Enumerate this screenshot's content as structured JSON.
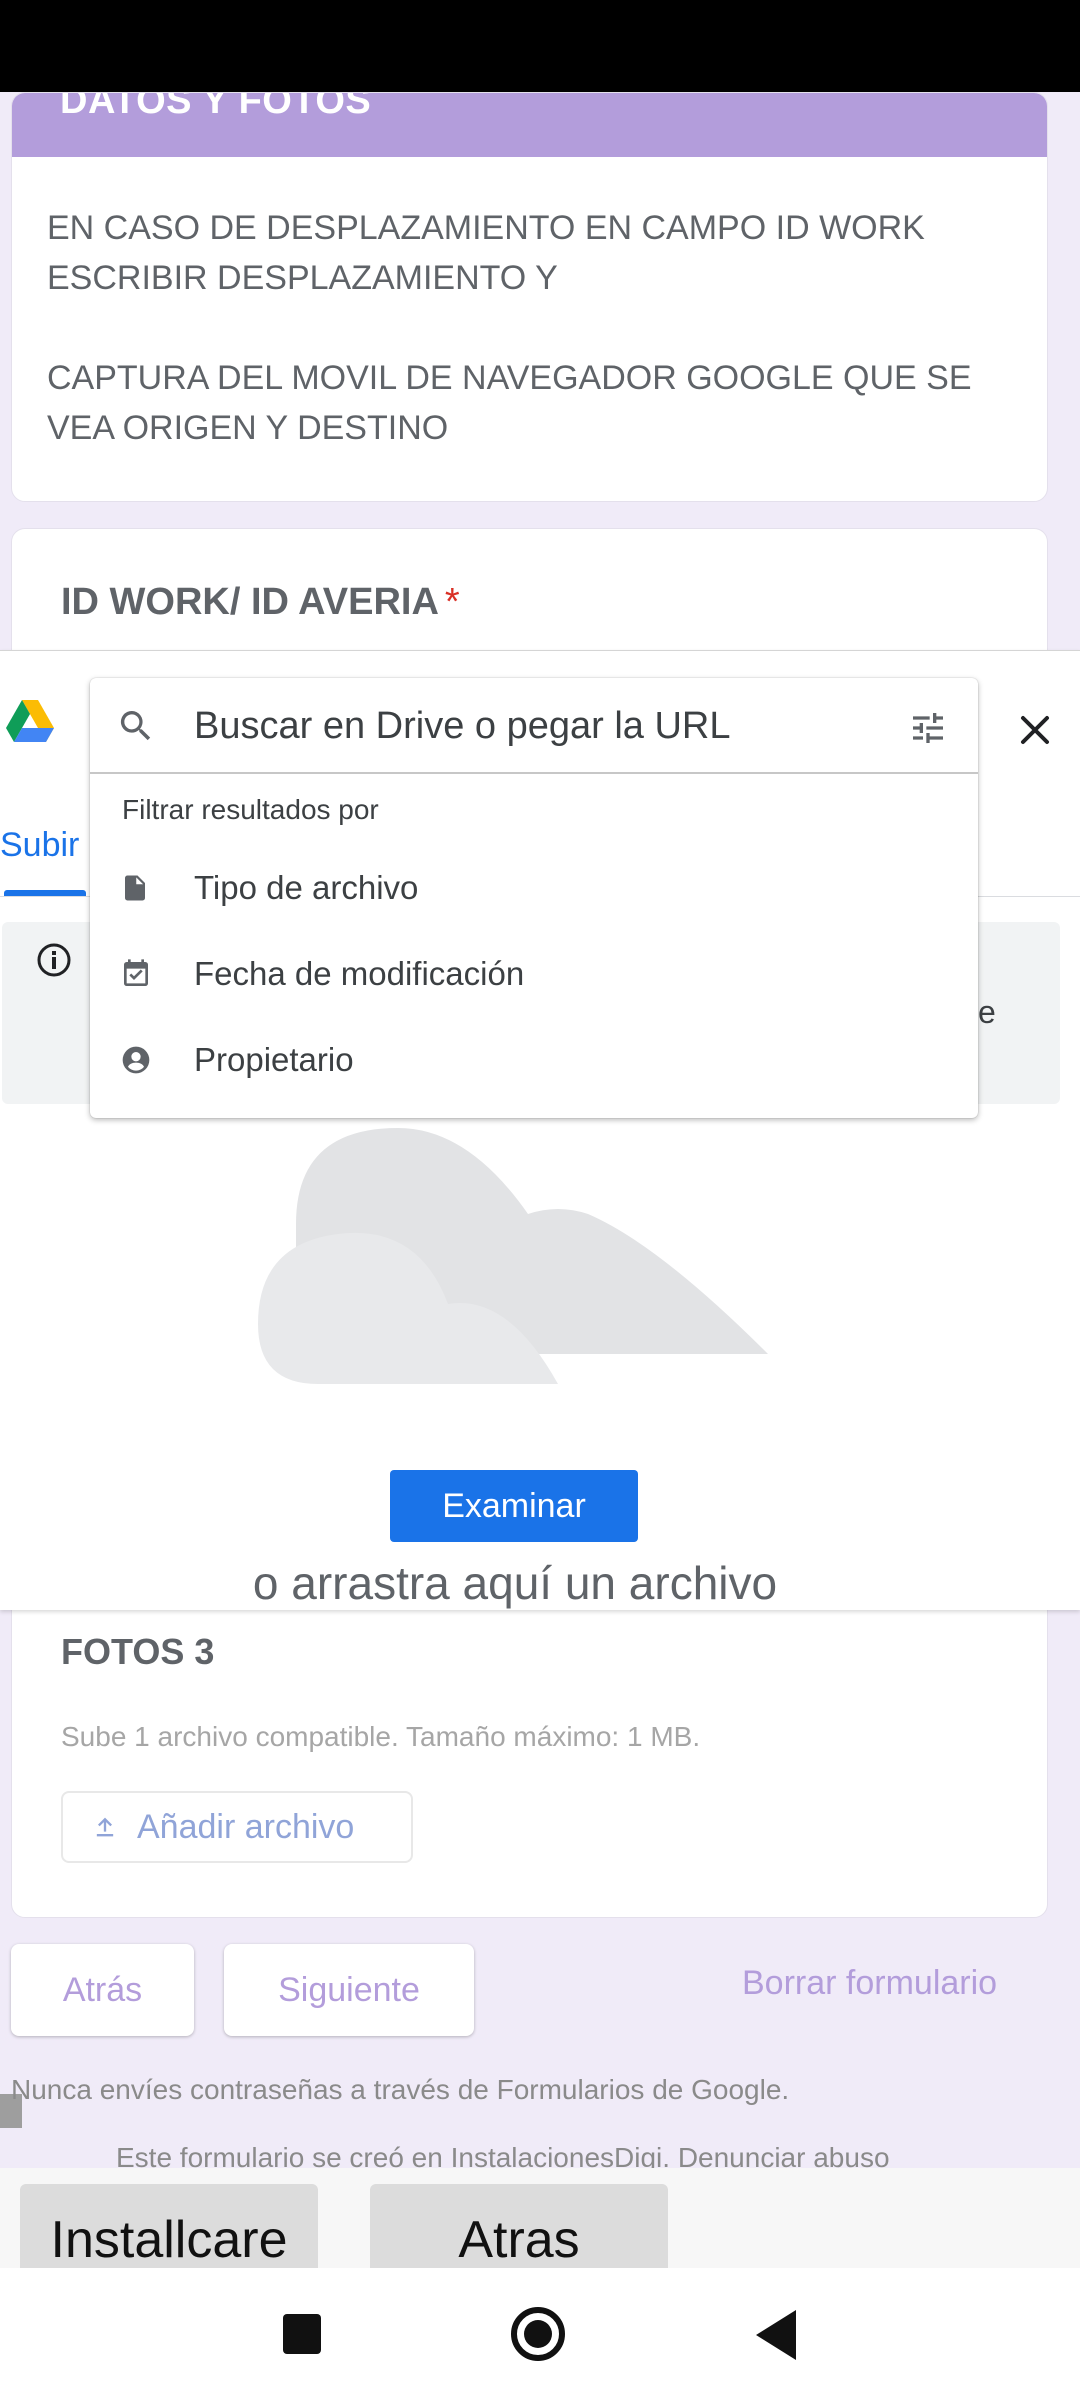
{
  "form": {
    "section_title": "DATOS Y FOTOS",
    "description_1": "EN CASO DE DESPLAZAMIENTO EN CAMPO ID WORK ESCRIBIR DESPLAZAMIENTO Y",
    "description_2": "CAPTURA DEL MOVIL DE NAVEGADOR GOOGLE QUE SE VEA ORIGEN Y DESTINO",
    "id_work_label": "ID WORK/ ID AVERIA",
    "required_mark": "*",
    "fotos3_title": "FOTOS 3",
    "fotos3_hint": "Sube 1 archivo compatible. Tamaño máximo: 1 MB.",
    "add_file_label": "Añadir archivo",
    "back_label": "Atrás",
    "next_label": "Siguiente",
    "clear_label": "Borrar formulario",
    "never_send": "Nunca envíes contraseñas a través de Formularios de Google.",
    "created_by": "Este formulario se creó en InstalacionesDigi. Denunciar abuso"
  },
  "picker": {
    "tab_upload": "Subir",
    "info_fragment": "e",
    "browse_label": "Examinar",
    "drag_text": "o arrastra aquí un archivo",
    "search": {
      "placeholder": "Buscar en Drive o pegar la URL",
      "filter_heading": "Filtrar resultados por",
      "filters": [
        {
          "label": "Tipo de archivo",
          "icon": "file-icon"
        },
        {
          "label": "Fecha de modificación",
          "icon": "calendar-check-icon"
        },
        {
          "label": "Propietario",
          "icon": "account-circle-icon"
        }
      ]
    }
  },
  "app_bar": {
    "installcare_label": "Installcare",
    "atras_label": "Atras"
  },
  "colors": {
    "accent_purple": "#b39ddb",
    "google_blue": "#1a73e8",
    "form_bg": "#f0ebf8"
  }
}
